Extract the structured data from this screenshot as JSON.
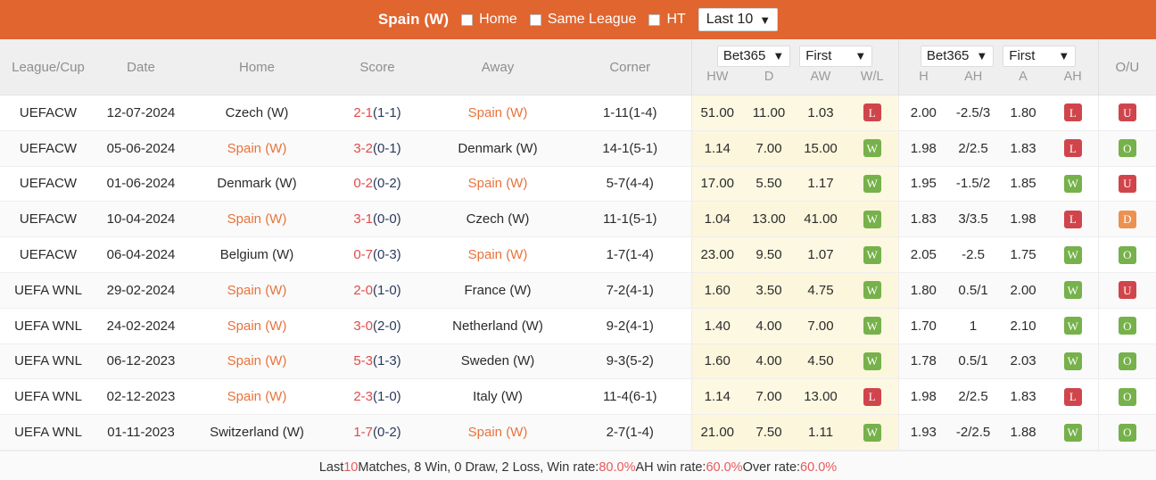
{
  "topbar": {
    "team": "Spain (W)",
    "filters": [
      {
        "label": "Home",
        "checked": false
      },
      {
        "label": "Same League",
        "checked": false
      },
      {
        "label": "HT",
        "checked": false
      }
    ],
    "range_select": "Last 10"
  },
  "columns": {
    "league": "League/Cup",
    "date": "Date",
    "home": "Home",
    "score": "Score",
    "away": "Away",
    "corner": "Corner",
    "ou": "O/U"
  },
  "odds_group_1": {
    "bookmaker": "Bet365",
    "period": "First",
    "sub": [
      "HW",
      "D",
      "AW",
      "W/L"
    ]
  },
  "odds_group_2": {
    "bookmaker": "Bet365",
    "period": "First",
    "sub": [
      "H",
      "AH",
      "A",
      "AH"
    ]
  },
  "rows": [
    {
      "league": "UEFACW",
      "date": "12-07-2024",
      "home": "Czech (W)",
      "home_hl": false,
      "score_main": "2-1",
      "score_ht": "(1-1)",
      "away": "Spain (W)",
      "away_hl": true,
      "corner": "1-11(1-4)",
      "hw": "51.00",
      "d": "11.00",
      "aw": "1.03",
      "wl": "L",
      "wl_type": "l",
      "h": "2.00",
      "ah": "-2.5/3",
      "a": "1.80",
      "ah_res": "L",
      "ah_type": "l",
      "ou": "U",
      "ou_type": "u"
    },
    {
      "league": "UEFACW",
      "date": "05-06-2024",
      "home": "Spain (W)",
      "home_hl": true,
      "score_main": "3-2",
      "score_ht": "(0-1)",
      "away": "Denmark (W)",
      "away_hl": false,
      "corner": "14-1(5-1)",
      "hw": "1.14",
      "d": "7.00",
      "aw": "15.00",
      "wl": "W",
      "wl_type": "w",
      "h": "1.98",
      "ah": "2/2.5",
      "a": "1.83",
      "ah_res": "L",
      "ah_type": "l",
      "ou": "O",
      "ou_type": "o"
    },
    {
      "league": "UEFACW",
      "date": "01-06-2024",
      "home": "Denmark (W)",
      "home_hl": false,
      "score_main": "0-2",
      "score_ht": "(0-2)",
      "away": "Spain (W)",
      "away_hl": true,
      "corner": "5-7(4-4)",
      "hw": "17.00",
      "d": "5.50",
      "aw": "1.17",
      "wl": "W",
      "wl_type": "w",
      "h": "1.95",
      "ah": "-1.5/2",
      "a": "1.85",
      "ah_res": "W",
      "ah_type": "w",
      "ou": "U",
      "ou_type": "u"
    },
    {
      "league": "UEFACW",
      "date": "10-04-2024",
      "home": "Spain (W)",
      "home_hl": true,
      "score_main": "3-1",
      "score_ht": "(0-0)",
      "away": "Czech (W)",
      "away_hl": false,
      "corner": "11-1(5-1)",
      "hw": "1.04",
      "d": "13.00",
      "aw": "41.00",
      "wl": "W",
      "wl_type": "w",
      "h": "1.83",
      "ah": "3/3.5",
      "a": "1.98",
      "ah_res": "L",
      "ah_type": "l",
      "ou": "D",
      "ou_type": "d"
    },
    {
      "league": "UEFACW",
      "date": "06-04-2024",
      "home": "Belgium (W)",
      "home_hl": false,
      "score_main": "0-7",
      "score_ht": "(0-3)",
      "away": "Spain (W)",
      "away_hl": true,
      "corner": "1-7(1-4)",
      "hw": "23.00",
      "d": "9.50",
      "aw": "1.07",
      "wl": "W",
      "wl_type": "w",
      "h": "2.05",
      "ah": "-2.5",
      "a": "1.75",
      "ah_res": "W",
      "ah_type": "w",
      "ou": "O",
      "ou_type": "o"
    },
    {
      "league": "UEFA WNL",
      "date": "29-02-2024",
      "home": "Spain (W)",
      "home_hl": true,
      "score_main": "2-0",
      "score_ht": "(1-0)",
      "away": "France (W)",
      "away_hl": false,
      "corner": "7-2(4-1)",
      "hw": "1.60",
      "d": "3.50",
      "aw": "4.75",
      "wl": "W",
      "wl_type": "w",
      "h": "1.80",
      "ah": "0.5/1",
      "a": "2.00",
      "ah_res": "W",
      "ah_type": "w",
      "ou": "U",
      "ou_type": "u"
    },
    {
      "league": "UEFA WNL",
      "date": "24-02-2024",
      "home": "Spain (W)",
      "home_hl": true,
      "score_main": "3-0",
      "score_ht": "(2-0)",
      "away": "Netherland (W)",
      "away_hl": false,
      "corner": "9-2(4-1)",
      "hw": "1.40",
      "d": "4.00",
      "aw": "7.00",
      "wl": "W",
      "wl_type": "w",
      "h": "1.70",
      "ah": "1",
      "a": "2.10",
      "ah_res": "W",
      "ah_type": "w",
      "ou": "O",
      "ou_type": "o"
    },
    {
      "league": "UEFA WNL",
      "date": "06-12-2023",
      "home": "Spain (W)",
      "home_hl": true,
      "score_main": "5-3",
      "score_ht": "(1-3)",
      "away": "Sweden (W)",
      "away_hl": false,
      "corner": "9-3(5-2)",
      "hw": "1.60",
      "d": "4.00",
      "aw": "4.50",
      "wl": "W",
      "wl_type": "w",
      "h": "1.78",
      "ah": "0.5/1",
      "a": "2.03",
      "ah_res": "W",
      "ah_type": "w",
      "ou": "O",
      "ou_type": "o"
    },
    {
      "league": "UEFA WNL",
      "date": "02-12-2023",
      "home": "Spain (W)",
      "home_hl": true,
      "score_main": "2-3",
      "score_ht": "(1-0)",
      "away": "Italy (W)",
      "away_hl": false,
      "corner": "11-4(6-1)",
      "hw": "1.14",
      "d": "7.00",
      "aw": "13.00",
      "wl": "L",
      "wl_type": "l",
      "h": "1.98",
      "ah": "2/2.5",
      "a": "1.83",
      "ah_res": "L",
      "ah_type": "l",
      "ou": "O",
      "ou_type": "o"
    },
    {
      "league": "UEFA WNL",
      "date": "01-11-2023",
      "home": "Switzerland (W)",
      "home_hl": false,
      "score_main": "1-7",
      "score_ht": "(0-2)",
      "away": "Spain (W)",
      "away_hl": true,
      "corner": "2-7(1-4)",
      "hw": "21.00",
      "d": "7.50",
      "aw": "1.11",
      "wl": "W",
      "wl_type": "w",
      "h": "1.93",
      "ah": "-2/2.5",
      "a": "1.88",
      "ah_res": "W",
      "ah_type": "w",
      "ou": "O",
      "ou_type": "o"
    }
  ],
  "footer": {
    "p1": "Last ",
    "matches_count": "10",
    "p2": " Matches, 8 Win, 0 Draw, 2 Loss, Win rate: ",
    "win_rate": "80.0%",
    "p3": " AH win rate: ",
    "ah_win_rate": "60.0%",
    "p4": " Over rate: ",
    "over_rate": "60.0%"
  },
  "colors": {
    "brand_orange": "#e0652f",
    "highlight": "#e8733c",
    "score_red": "#e04b4b",
    "win_green": "#76b14b",
    "loss_red": "#d0454c",
    "draw_orange": "#ed9150",
    "odds_band": "#fdf8e2"
  }
}
